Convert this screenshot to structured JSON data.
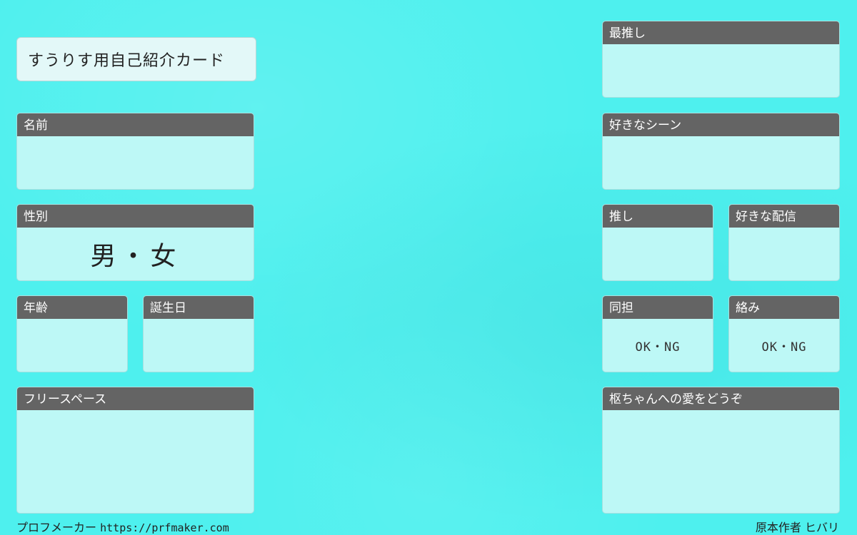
{
  "title": "すうりす用自己紹介カード",
  "cards": {
    "name": {
      "label": "名前"
    },
    "gender": {
      "label": "性別",
      "value": "男・女"
    },
    "age": {
      "label": "年齢"
    },
    "birthday": {
      "label": "誕生日"
    },
    "free_space": {
      "label": "フリースペース"
    },
    "favorite": {
      "label": "最推し"
    },
    "favorite_scene": {
      "label": "好きなシーン"
    },
    "oshi": {
      "label": "推し"
    },
    "favorite_stream": {
      "label": "好きな配信"
    },
    "same_fan": {
      "label": "同担",
      "value": "OK・NG"
    },
    "interaction": {
      "label": "絡み",
      "value": "OK・NG"
    },
    "love_message": {
      "label": "枢ちゃんへの愛をどうぞ"
    }
  },
  "footer": {
    "maker": "プロフメーカー",
    "url": "https://prfmaker.com",
    "author": "原本作者 ヒバリ"
  },
  "colors": {
    "background": "#4ef0ee",
    "header": "#646464",
    "card_body": "#bdf8f6"
  }
}
